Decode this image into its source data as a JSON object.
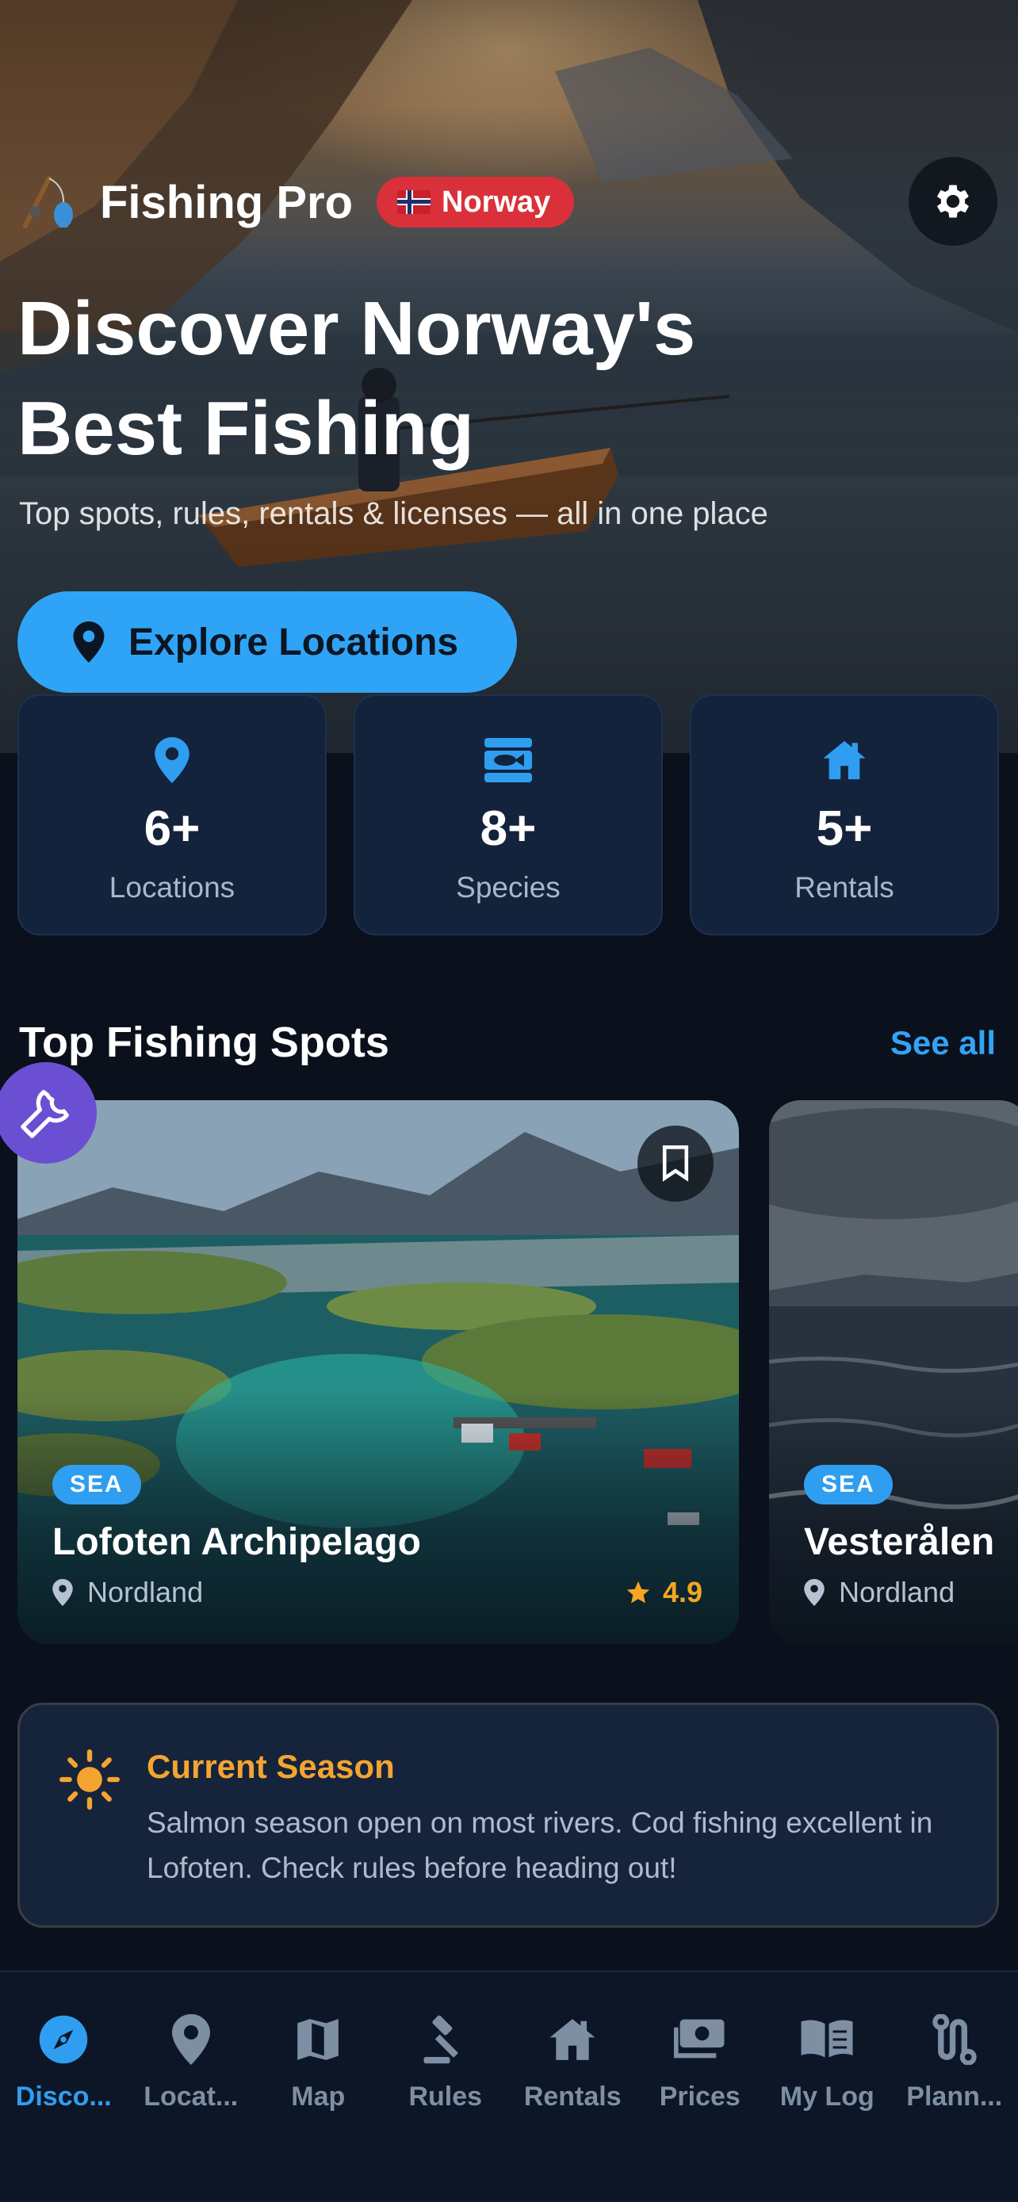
{
  "header": {
    "app_title": "Fishing Pro",
    "country": "Norway",
    "logo_icon": "fishing-rod-icon",
    "settings_icon": "gear-icon"
  },
  "hero": {
    "title": "Discover Norway's Best Fishing",
    "subtitle": "Top spots, rules, rentals & licenses — all in one place",
    "cta_label": "Explore Locations",
    "cta_icon": "location-pin-icon"
  },
  "stats": [
    {
      "icon": "location-pin-icon",
      "value": "6+",
      "label": "Locations"
    },
    {
      "icon": "fish-icon",
      "value": "8+",
      "label": "Species"
    },
    {
      "icon": "house-icon",
      "value": "5+",
      "label": "Rentals"
    }
  ],
  "top_spots": {
    "title": "Top Fishing Spots",
    "see_all": "See all",
    "cards": [
      {
        "badge": "SEA",
        "name": "Lofoten Archipelago",
        "region": "Nordland",
        "rating": "4.9"
      },
      {
        "badge": "SEA",
        "name": "Vesterålen",
        "region": "Nordland"
      }
    ]
  },
  "season": {
    "title": "Current Season",
    "text": "Salmon season open on most rivers. Cod fishing excellent in Lofoten. Check rules before heading out!",
    "icon": "sun-icon"
  },
  "nav": [
    {
      "label": "Disco...",
      "icon": "compass-icon",
      "active": true
    },
    {
      "label": "Locat...",
      "icon": "location-pin-icon"
    },
    {
      "label": "Map",
      "icon": "map-icon"
    },
    {
      "label": "Rules",
      "icon": "gavel-icon"
    },
    {
      "label": "Rentals",
      "icon": "house-icon"
    },
    {
      "label": "Prices",
      "icon": "money-icon"
    },
    {
      "label": "My Log",
      "icon": "book-icon"
    },
    {
      "label": "Plann...",
      "icon": "route-icon"
    }
  ],
  "colors": {
    "accent": "#2f9ef0",
    "country_pill": "#d9303a",
    "season_title": "#f3a431",
    "card_bg": "#13233c",
    "page_bg": "#0a111c"
  }
}
